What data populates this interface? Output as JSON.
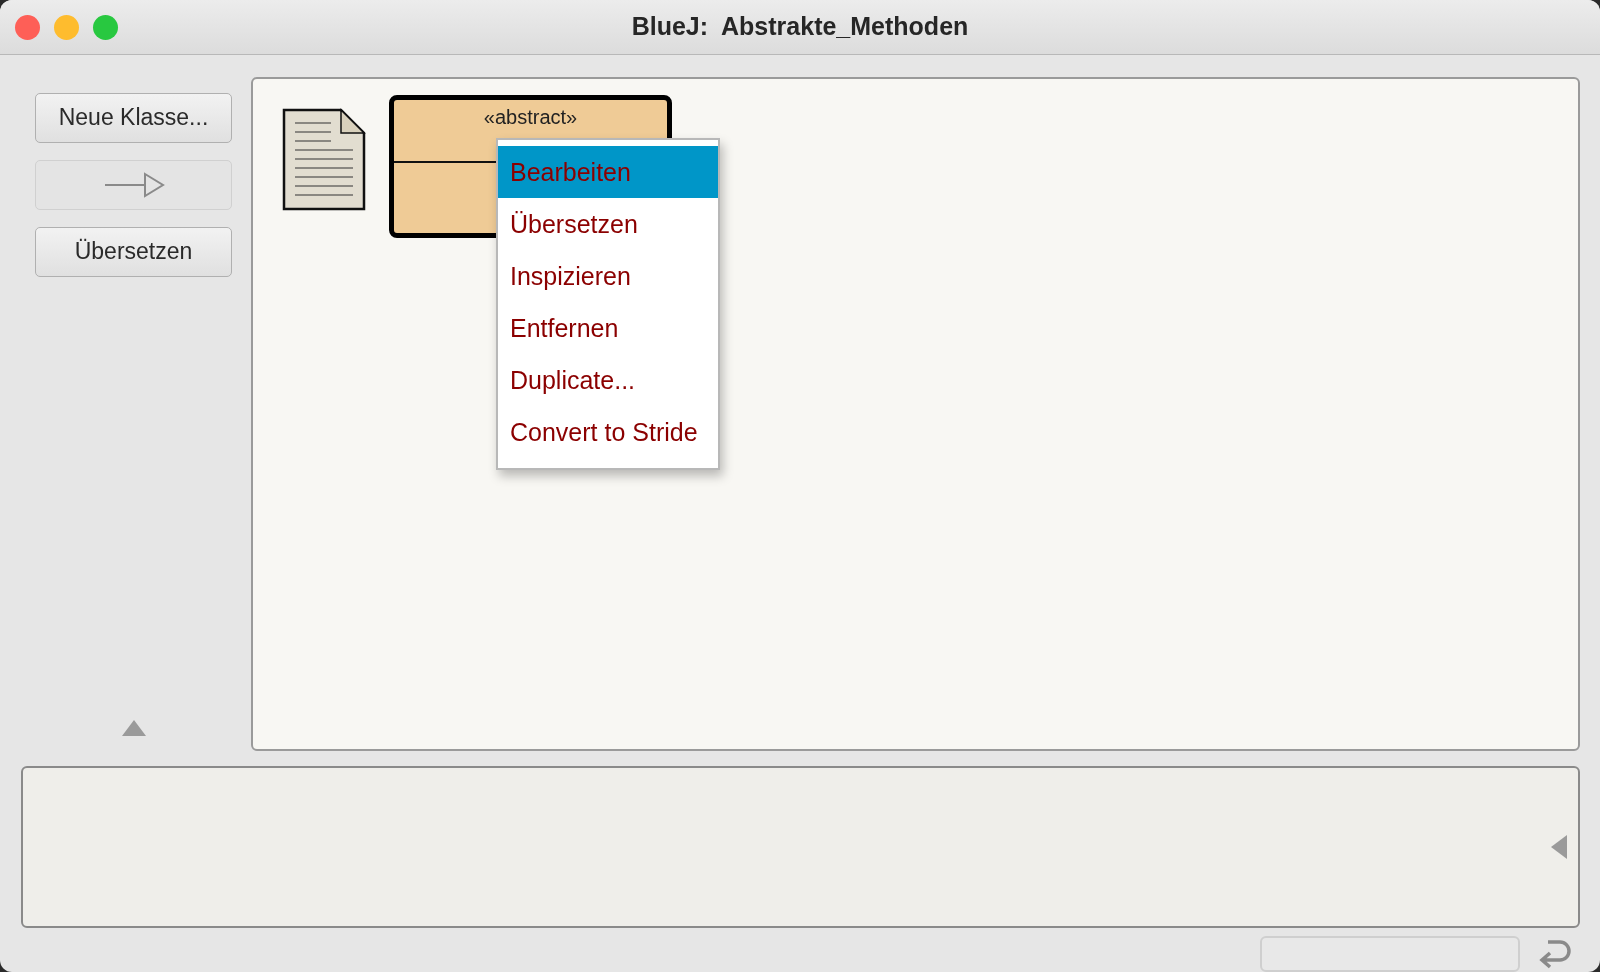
{
  "window": {
    "title": "BlueJ:  Abstrakte_Methoden"
  },
  "sidebar": {
    "buttons": [
      {
        "kind": "text",
        "label": "Neue Klasse...",
        "disabled": false
      },
      {
        "kind": "arrow",
        "disabled": true
      },
      {
        "kind": "text",
        "label": "Übersetzen",
        "disabled": false
      }
    ]
  },
  "diagram": {
    "class_box": {
      "stereotype": "«abstract»"
    }
  },
  "context_menu": {
    "items": [
      {
        "label": "Bearbeiten",
        "selected": true
      },
      {
        "label": "Übersetzen",
        "selected": false
      },
      {
        "label": "Inspizieren",
        "selected": false
      },
      {
        "label": "Entfernen",
        "selected": false
      },
      {
        "label": "Duplicate...",
        "selected": false
      },
      {
        "label": "Convert to Stride",
        "selected": false
      }
    ]
  }
}
